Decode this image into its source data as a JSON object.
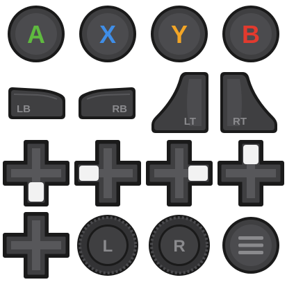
{
  "colors": {
    "outline": "#1a1a1a",
    "body": "#3f3f41",
    "inner": "#57575a",
    "highlight": "#6a6a6d",
    "label_gray": "#8a8a8d",
    "pressed": "#f2f2f2",
    "a": "#5fba3f",
    "x": "#3f8ee8",
    "y": "#f2a526",
    "b": "#e23a2e"
  },
  "face_buttons": [
    {
      "id": "a",
      "label": "A"
    },
    {
      "id": "x",
      "label": "X"
    },
    {
      "id": "y",
      "label": "Y"
    },
    {
      "id": "b",
      "label": "B"
    }
  ],
  "bumpers": {
    "left": "LB",
    "right": "RB"
  },
  "triggers": {
    "left": "LT",
    "right": "RT"
  },
  "dpad_states": [
    "down",
    "left",
    "right",
    "up",
    "none"
  ],
  "sticks": {
    "left": "L",
    "right": "R"
  },
  "menu_icon": "menu-icon"
}
